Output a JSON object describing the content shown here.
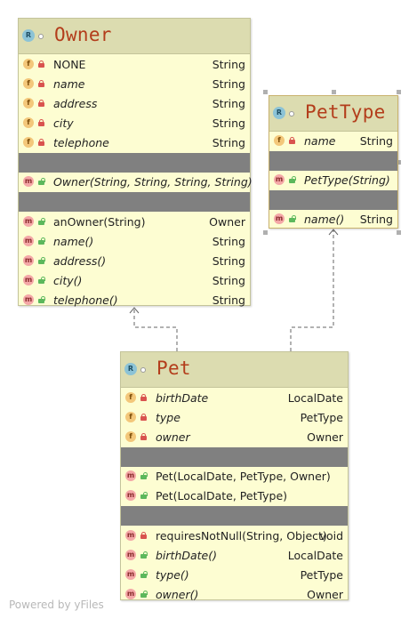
{
  "classes": {
    "owner": {
      "kind_badge": "R",
      "name": "Owner",
      "fields": [
        {
          "name": "NONE",
          "type": "String",
          "italic": false
        },
        {
          "name": "name",
          "type": "String",
          "italic": true
        },
        {
          "name": "address",
          "type": "String",
          "italic": true
        },
        {
          "name": "city",
          "type": "String",
          "italic": true
        },
        {
          "name": "telephone",
          "type": "String",
          "italic": true
        }
      ],
      "constructors": [
        {
          "name": "Owner(String, String, String, String)",
          "type": "",
          "italic": true
        }
      ],
      "methods": [
        {
          "name": "anOwner(String)",
          "type": "Owner",
          "italic": false
        },
        {
          "name": "name()",
          "type": "String",
          "italic": true
        },
        {
          "name": "address()",
          "type": "String",
          "italic": true
        },
        {
          "name": "city()",
          "type": "String",
          "italic": true
        },
        {
          "name": "telephone()",
          "type": "String",
          "italic": true
        }
      ]
    },
    "pettype": {
      "kind_badge": "R",
      "name": "PetType",
      "fields": [
        {
          "name": "name",
          "type": "String",
          "italic": true
        }
      ],
      "constructors": [
        {
          "name": "PetType(String)",
          "type": "",
          "italic": true
        }
      ],
      "methods": [
        {
          "name": "name()",
          "type": "String",
          "italic": true
        }
      ]
    },
    "pet": {
      "kind_badge": "R",
      "name": "Pet",
      "fields": [
        {
          "name": "birthDate",
          "type": "LocalDate",
          "italic": true
        },
        {
          "name": "type",
          "type": "PetType",
          "italic": true
        },
        {
          "name": "owner",
          "type": "Owner",
          "italic": true
        }
      ],
      "constructors": [
        {
          "name": "Pet(LocalDate, PetType, Owner)",
          "type": "",
          "italic": false
        },
        {
          "name": "Pet(LocalDate, PetType)",
          "type": "",
          "italic": false
        }
      ],
      "methods": [
        {
          "name": "requiresNotNull(String, Object)",
          "type": "void",
          "italic": false
        },
        {
          "name": "birthDate()",
          "type": "LocalDate",
          "italic": true
        },
        {
          "name": "type()",
          "type": "PetType",
          "italic": true
        },
        {
          "name": "owner()",
          "type": "Owner",
          "italic": true
        }
      ]
    }
  },
  "icons": {
    "field": "f",
    "method": "m"
  },
  "colors": {
    "class_name": "#b33d1b",
    "header": "#dcdcb0",
    "body": "#fdfdd2",
    "separator": "#808080"
  },
  "footer": "Powered by yFiles"
}
